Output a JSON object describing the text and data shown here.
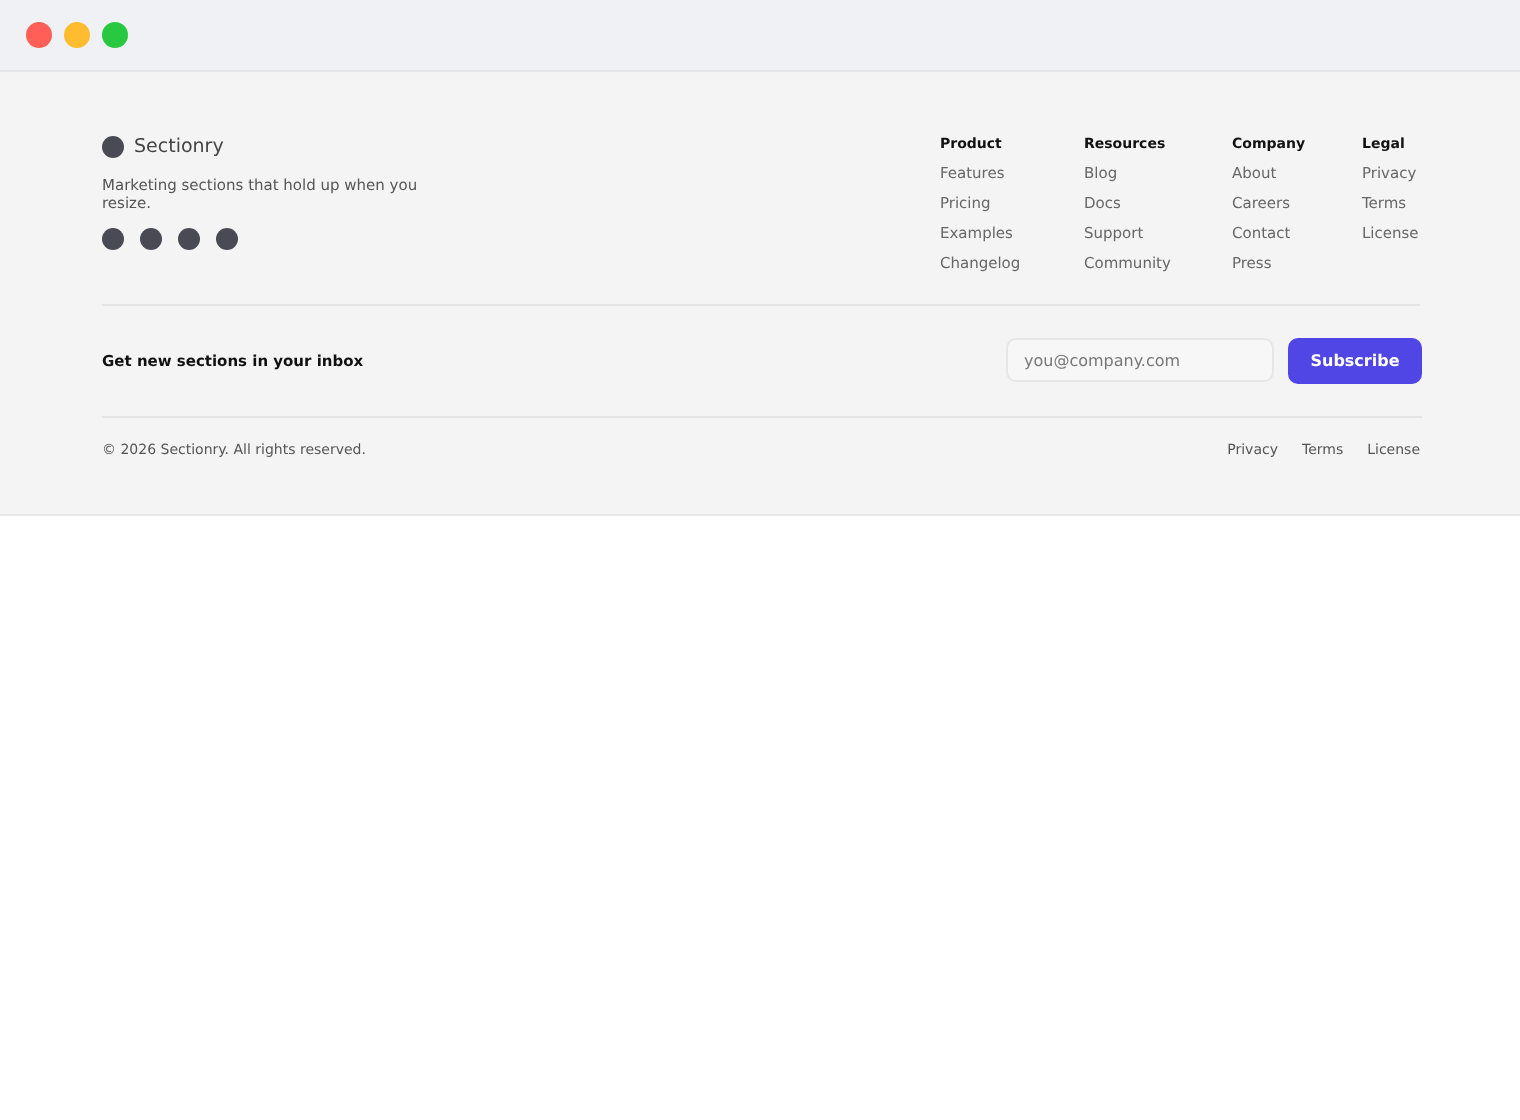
{
  "brand": {
    "name": "Sectionry",
    "tagline": "Marketing sections that hold up when you resize.",
    "social": [
      {
        "kind": "circle"
      },
      {
        "kind": "circle"
      },
      {
        "kind": "circle"
      },
      {
        "kind": "circle"
      }
    ]
  },
  "columns": [
    {
      "title": "Product",
      "links": [
        "Features",
        "Pricing",
        "Examples",
        "Changelog"
      ]
    },
    {
      "title": "Resources",
      "links": [
        "Blog",
        "Docs",
        "Support",
        "Community"
      ]
    },
    {
      "title": "Company",
      "links": [
        "About",
        "Careers",
        "Contact",
        "Press"
      ]
    },
    {
      "title": "Legal",
      "links": [
        "Privacy",
        "Terms",
        "License"
      ]
    }
  ],
  "newsletter": {
    "label": "Get new sections in your inbox",
    "placeholder": "you@company.com",
    "button": "Subscribe"
  },
  "bottom": {
    "copyright": "© 2026 Sectionry. All rights reserved.",
    "links": [
      "Privacy",
      "Terms",
      "License"
    ]
  }
}
